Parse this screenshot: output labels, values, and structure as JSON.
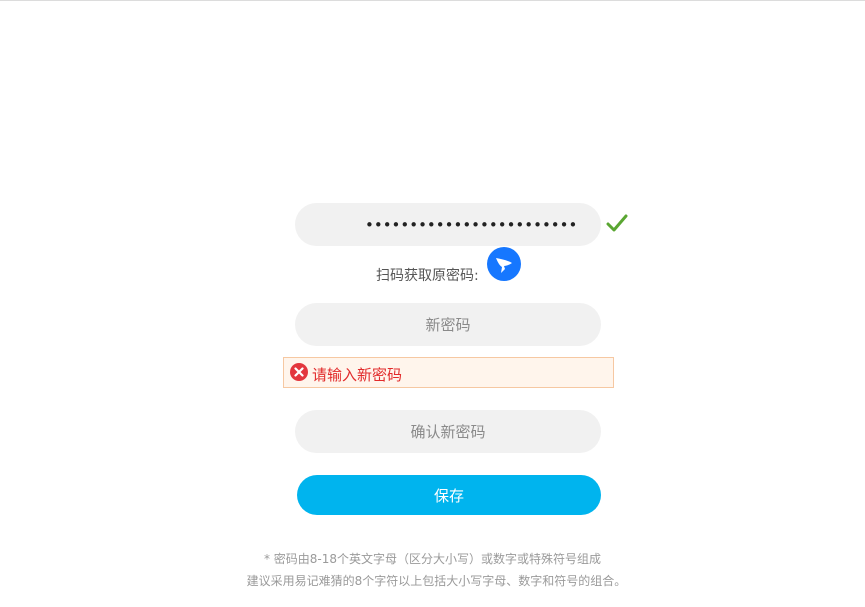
{
  "form": {
    "old_password_value": "••••••••••••••••••••••••",
    "old_password_valid": true,
    "scan_label": "扫码获取原密码:",
    "new_password_placeholder": "新密码",
    "error_message": "请输入新密码",
    "confirm_password_placeholder": "确认新密码",
    "save_label": "保存"
  },
  "hints": {
    "line1": "* 密码由8-18个英文字母（区分大小写）或数字或特殊符号组成",
    "line2": "建议采用易记难猜的8个字符以上包括大小写字母、数字和符号的组合。"
  },
  "icons": {
    "valid": "checkmark-icon",
    "scan": "dingtalk-scan-icon",
    "error": "error-circle-icon"
  },
  "colors": {
    "primary_button": "#00b4ee",
    "error": "#e22b2b",
    "valid": "#5aa632",
    "scan_icon": "#1677ff"
  }
}
